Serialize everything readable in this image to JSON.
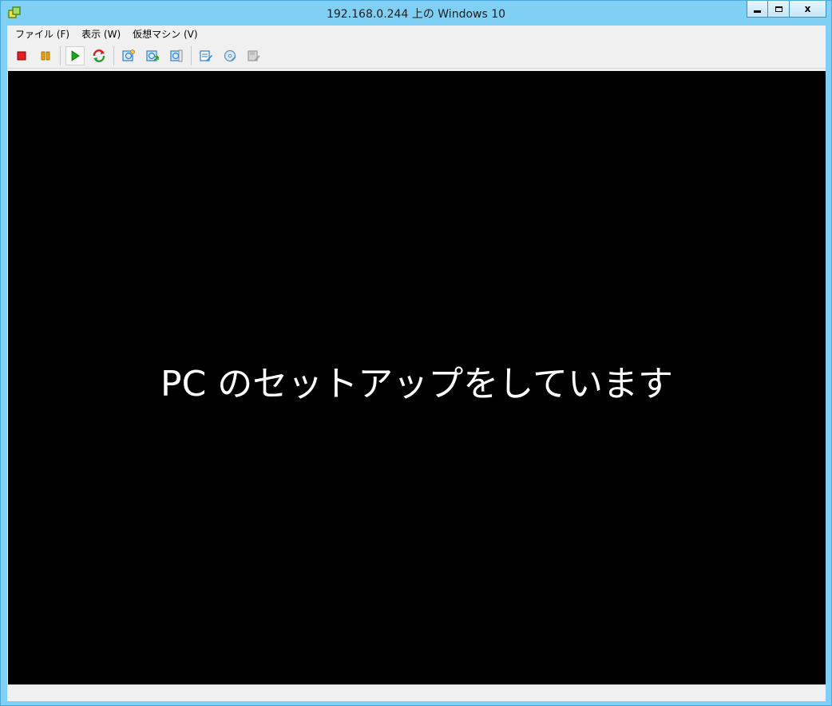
{
  "window": {
    "title": "192.168.0.244 上の Windows 10",
    "close_glyph": "x"
  },
  "menu": [
    {
      "label": "ファイル (F)"
    },
    {
      "label": "表示 (W)"
    },
    {
      "label": "仮想マシン (V)"
    }
  ],
  "toolbar": [
    {
      "icon": "stop-icon",
      "color": "#e02020"
    },
    {
      "icon": "pause-icon",
      "color": "#f0a000"
    },
    {
      "icon": "play-icon",
      "color": "#1aa51a"
    },
    {
      "icon": "reset-icon",
      "color": "#d02020"
    },
    {
      "icon": "snapshot-icon",
      "color": "#2a7fd4"
    },
    {
      "icon": "revert-snapshot-icon",
      "color": "#2a7fd4"
    },
    {
      "icon": "snapshot-manager-icon",
      "color": "#2a7fd4"
    },
    {
      "icon": "edit-settings-icon",
      "color": "#2a7fd4"
    },
    {
      "icon": "cd-dvd-icon",
      "color": "#5a8fc0"
    },
    {
      "icon": "floppy-connect-icon",
      "color": "#9a9a9a"
    }
  ],
  "console": {
    "message": "PC のセットアップをしています",
    "background": "#000000",
    "text_color": "#ffffff"
  }
}
